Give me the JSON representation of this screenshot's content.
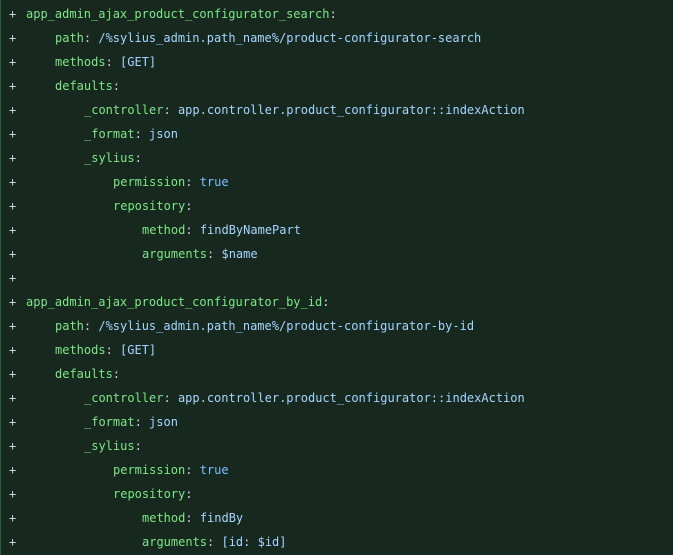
{
  "diff": {
    "marker": "+",
    "lines": [
      {
        "indent": 0,
        "key": "app_admin_ajax_product_configurator_search",
        "sep": ":",
        "value": "",
        "vtype": ""
      },
      {
        "indent": 1,
        "key": "path",
        "sep": ": ",
        "value": "/%sylius_admin.path_name%/product-configurator-search",
        "vtype": "v"
      },
      {
        "indent": 1,
        "key": "methods",
        "sep": ": ",
        "value": "[GET]",
        "vtype": "v"
      },
      {
        "indent": 1,
        "key": "defaults",
        "sep": ":",
        "value": "",
        "vtype": ""
      },
      {
        "indent": 2,
        "key": "_controller",
        "sep": ": ",
        "value": "app.controller.product_configurator::indexAction",
        "vtype": "v"
      },
      {
        "indent": 2,
        "key": "_format",
        "sep": ": ",
        "value": "json",
        "vtype": "v"
      },
      {
        "indent": 2,
        "key": "_sylius",
        "sep": ":",
        "value": "",
        "vtype": ""
      },
      {
        "indent": 3,
        "key": "permission",
        "sep": ": ",
        "value": "true",
        "vtype": "b"
      },
      {
        "indent": 3,
        "key": "repository",
        "sep": ":",
        "value": "",
        "vtype": ""
      },
      {
        "indent": 4,
        "key": "method",
        "sep": ": ",
        "value": "findByNamePart",
        "vtype": "v"
      },
      {
        "indent": 4,
        "key": "arguments",
        "sep": ": ",
        "value": "$name",
        "vtype": "v"
      },
      {
        "indent": 0,
        "key": "",
        "sep": "",
        "value": "",
        "vtype": ""
      },
      {
        "indent": 0,
        "key": "app_admin_ajax_product_configurator_by_id",
        "sep": ":",
        "value": "",
        "vtype": ""
      },
      {
        "indent": 1,
        "key": "path",
        "sep": ": ",
        "value": "/%sylius_admin.path_name%/product-configurator-by-id",
        "vtype": "v"
      },
      {
        "indent": 1,
        "key": "methods",
        "sep": ": ",
        "value": "[GET]",
        "vtype": "v"
      },
      {
        "indent": 1,
        "key": "defaults",
        "sep": ":",
        "value": "",
        "vtype": ""
      },
      {
        "indent": 2,
        "key": "_controller",
        "sep": ": ",
        "value": "app.controller.product_configurator::indexAction",
        "vtype": "v"
      },
      {
        "indent": 2,
        "key": "_format",
        "sep": ": ",
        "value": "json",
        "vtype": "v"
      },
      {
        "indent": 2,
        "key": "_sylius",
        "sep": ":",
        "value": "",
        "vtype": ""
      },
      {
        "indent": 3,
        "key": "permission",
        "sep": ": ",
        "value": "true",
        "vtype": "b"
      },
      {
        "indent": 3,
        "key": "repository",
        "sep": ":",
        "value": "",
        "vtype": ""
      },
      {
        "indent": 4,
        "key": "method",
        "sep": ": ",
        "value": "findBy",
        "vtype": "v"
      },
      {
        "indent": 4,
        "key": "arguments",
        "sep": ": ",
        "value": "[id: $id]",
        "vtype": "v"
      }
    ]
  },
  "colors": {
    "background": "#17281f",
    "key": "#7ee787",
    "value": "#a5d6ff",
    "boolean": "#79c0ff",
    "punctuation": "#c9d1d9"
  }
}
